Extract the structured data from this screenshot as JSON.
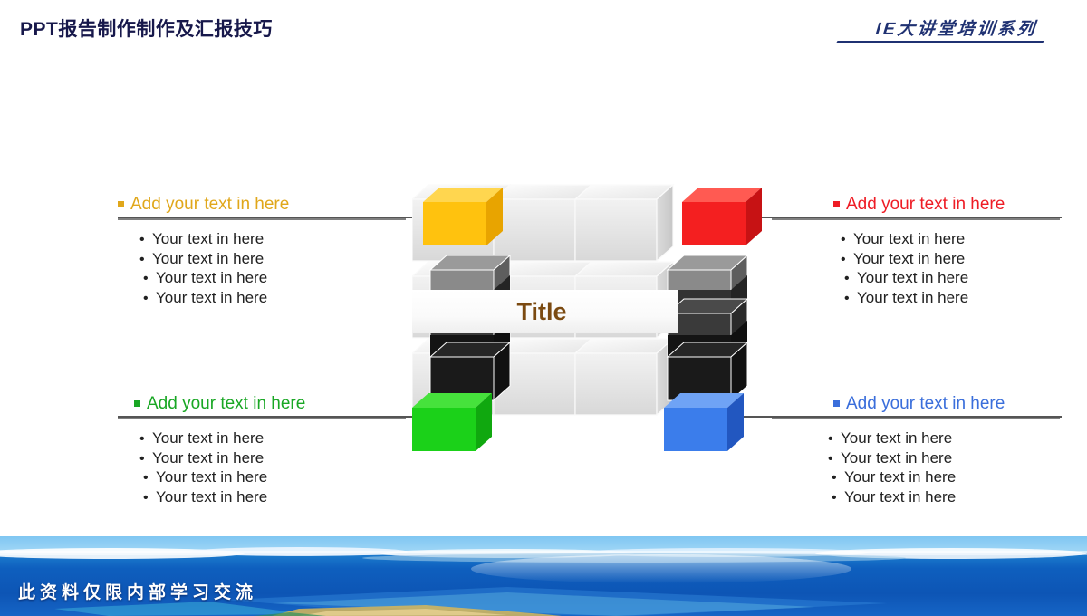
{
  "header": {
    "title": "PPT报告制作制作及汇报技巧",
    "brand": "IE大讲堂培训系列",
    "title_color": "#17184B",
    "brand_color": "#1F3172"
  },
  "diagram": {
    "center_label": "Title",
    "center_label_color": "#7B4A11",
    "connector_color": "#555555",
    "center_cube_color": "#E2E2E2",
    "side_cube_colors": [
      "#8A8A8A",
      "#3A3A3A",
      "#1A1A1A"
    ]
  },
  "quadrants": [
    {
      "id": "top-left",
      "heading": "Add your text in here",
      "color": "#E0A71B",
      "cube_color": "#FFC20E",
      "bullets": [
        "Your text in here",
        "Your text in here",
        "Your text in here",
        "Your text in here"
      ]
    },
    {
      "id": "top-right",
      "heading": "Add your text in here",
      "color": "#EE1C25",
      "cube_color": "#F41F20",
      "bullets": [
        "Your text in here",
        "Your text in here",
        "Your text in here",
        "Your text in here"
      ]
    },
    {
      "id": "bottom-left",
      "heading": "Add your text in here",
      "color": "#19A724",
      "cube_color": "#1BD119",
      "bullets": [
        "Your text in here",
        "Your text in here",
        "Your text in here",
        "Your text in here"
      ]
    },
    {
      "id": "bottom-right",
      "heading": "Add your text in here",
      "color": "#3A6EDB",
      "cube_color": "#3B7DEB",
      "bullets": [
        "Your text in here",
        "Your text in here",
        "Your text in here",
        "Your text in here"
      ]
    }
  ],
  "footer": {
    "text": "此资料仅限内部学习交流"
  }
}
